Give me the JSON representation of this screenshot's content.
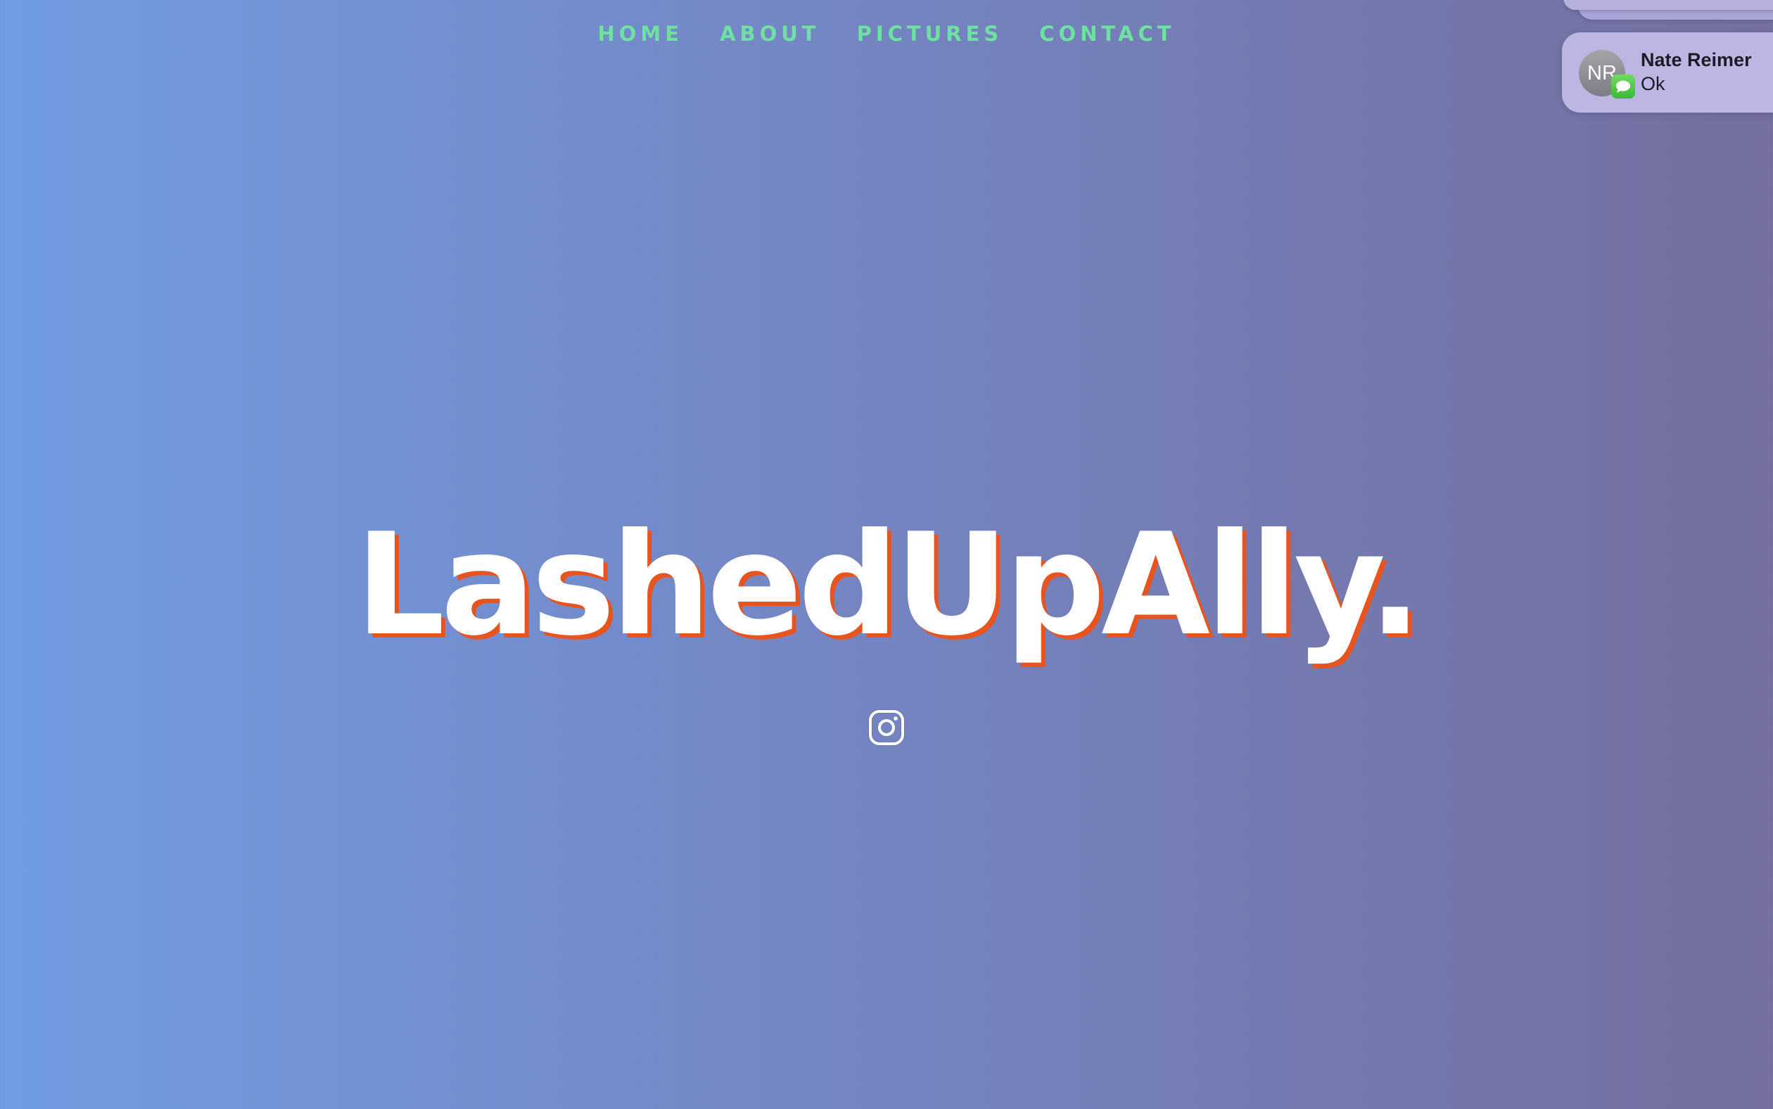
{
  "colors": {
    "gradient_left": "#719ce2",
    "gradient_right": "#746f9e",
    "nav_text": "#6ee0a2",
    "title_text": "#ffffff",
    "title_shadow": "#e8541e",
    "notification_bg": "#bbb6e2"
  },
  "nav": {
    "items": [
      {
        "label": "HOME"
      },
      {
        "label": "ABOUT"
      },
      {
        "label": "PICTURES"
      },
      {
        "label": "CONTACT"
      }
    ]
  },
  "hero": {
    "title": "LashedUpAlly.",
    "social_icon": "instagram-icon"
  },
  "notification": {
    "avatar_initials": "NR",
    "app_icon": "messages-icon",
    "sender": "Nate Reimer",
    "message": "Ok"
  }
}
